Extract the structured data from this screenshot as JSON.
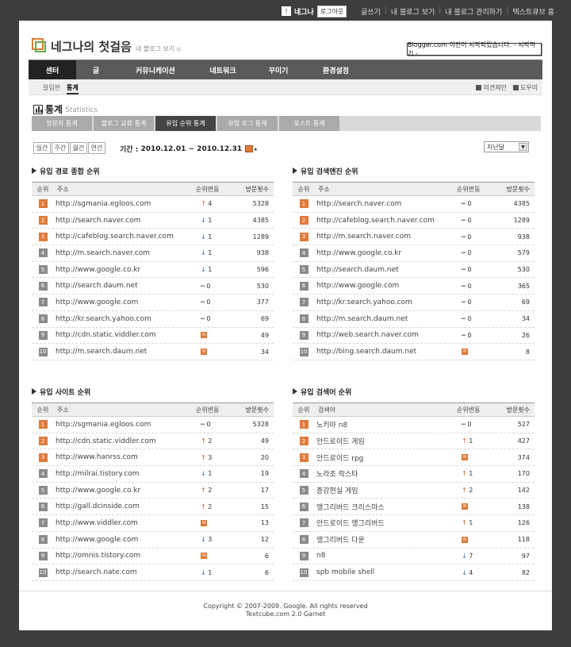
{
  "topbar": {
    "user_icon": "!",
    "user": "네그나",
    "logout": "로그아웃",
    "links": [
      "글쓰기",
      "내 블로그 보기",
      "내 블로그 관리하기",
      "텍스트큐브 홈"
    ]
  },
  "header": {
    "title": "네그나의 첫걸음",
    "view_blog": "내 블로그 보기",
    "notice": "Blogger.com 이전이 시작되었습니다. - 시작하기 -"
  },
  "nav": {
    "items": [
      "센터",
      "글",
      "커뮤니케이션",
      "네트워크",
      "꾸미기",
      "환경설정"
    ],
    "active": 0
  },
  "subnav": {
    "items": [
      "알림판",
      "통계"
    ],
    "active": 1,
    "right": [
      "의견제안",
      "도우미"
    ]
  },
  "stats": {
    "title": "통계",
    "title_en": "Statistics",
    "tabs": [
      "방문자 통계",
      "블로그 교류 통계",
      "유입 순위 통계",
      "유입 로그 통계",
      "포스트 통계"
    ],
    "active_tab": 2,
    "period_buttons": [
      "일간",
      "주간",
      "월간",
      "연간"
    ],
    "period_label": "기간 :",
    "period_value": "2010.12.01 ~ 2010.12.31",
    "period_select": "지난달"
  },
  "colors": {
    "accent_orange": "#e07a3a",
    "rank_grey": "#8a8a8a",
    "nav_bg": "#5a5a5a",
    "nav_active": "#222222"
  },
  "panels": [
    {
      "title": "유입 경로 종합 순위",
      "headers": [
        "순위",
        "주소",
        "순위변동",
        "방문횟수"
      ],
      "rows": [
        {
          "rank": "1",
          "name": "http://sgmania.egloos.com",
          "chg": "4",
          "dir": "up",
          "count": "5328"
        },
        {
          "rank": "2",
          "name": "http://search.naver.com",
          "chg": "1",
          "dir": "dn",
          "count": "4385"
        },
        {
          "rank": "3",
          "name": "http://cafeblog.search.naver.com",
          "chg": "1",
          "dir": "dn",
          "count": "1289"
        },
        {
          "rank": "4",
          "name": "http://m.search.naver.com",
          "chg": "1",
          "dir": "dn",
          "count": "938"
        },
        {
          "rank": "5",
          "name": "http://www.google.co.kr",
          "chg": "1",
          "dir": "dn",
          "count": "596"
        },
        {
          "rank": "6",
          "name": "http://search.daum.net",
          "chg": "0",
          "dir": "eq",
          "count": "530"
        },
        {
          "rank": "7",
          "name": "http://www.google.com",
          "chg": "0",
          "dir": "eq",
          "count": "377"
        },
        {
          "rank": "8",
          "name": "http://kr.search.yahoo.com",
          "chg": "0",
          "dir": "eq",
          "count": "69"
        },
        {
          "rank": "9",
          "name": "http://cdn.static.viddler.com",
          "chg": "N",
          "dir": "new",
          "count": "49"
        },
        {
          "rank": "10",
          "name": "http://m.search.daum.net",
          "chg": "N",
          "dir": "new",
          "count": "34"
        }
      ]
    },
    {
      "title": "유입 검색엔진 순위",
      "headers": [
        "순위",
        "주소",
        "순위변동",
        "방문횟수"
      ],
      "rows": [
        {
          "rank": "1",
          "name": "http://search.naver.com",
          "chg": "0",
          "dir": "eq",
          "count": "4385"
        },
        {
          "rank": "2",
          "name": "http://cafeblog.search.naver.com",
          "chg": "0",
          "dir": "eq",
          "count": "1289"
        },
        {
          "rank": "3",
          "name": "http://m.search.naver.com",
          "chg": "0",
          "dir": "eq",
          "count": "938"
        },
        {
          "rank": "4",
          "name": "http://www.google.co.kr",
          "chg": "0",
          "dir": "eq",
          "count": "579"
        },
        {
          "rank": "5",
          "name": "http://search.daum.net",
          "chg": "0",
          "dir": "eq",
          "count": "530"
        },
        {
          "rank": "6",
          "name": "http://www.google.com",
          "chg": "0",
          "dir": "eq",
          "count": "365"
        },
        {
          "rank": "7",
          "name": "http://kr.search.yahoo.com",
          "chg": "0",
          "dir": "eq",
          "count": "69"
        },
        {
          "rank": "8",
          "name": "http://m.search.daum.net",
          "chg": "0",
          "dir": "eq",
          "count": "34"
        },
        {
          "rank": "9",
          "name": "http://web.search.naver.com",
          "chg": "0",
          "dir": "eq",
          "count": "26"
        },
        {
          "rank": "10",
          "name": "http://bing.search.daum.net",
          "chg": "N",
          "dir": "new",
          "count": "8"
        }
      ]
    },
    {
      "title": "유입 사이트 순위",
      "headers": [
        "순위",
        "주소",
        "순위변동",
        "방문횟수"
      ],
      "rows": [
        {
          "rank": "1",
          "name": "http://sgmania.egloos.com",
          "chg": "0",
          "dir": "eq",
          "count": "5328"
        },
        {
          "rank": "2",
          "name": "http://cdn.static.viddler.com",
          "chg": "2",
          "dir": "up",
          "count": "49"
        },
        {
          "rank": "3",
          "name": "http://www.hanrss.com",
          "chg": "3",
          "dir": "up",
          "count": "20"
        },
        {
          "rank": "4",
          "name": "http://milrai.tistory.com",
          "chg": "1",
          "dir": "dn",
          "count": "19"
        },
        {
          "rank": "5",
          "name": "http://www.google.co.kr",
          "chg": "2",
          "dir": "up",
          "count": "17"
        },
        {
          "rank": "6",
          "name": "http://gall.dcinside.com",
          "chg": "2",
          "dir": "up",
          "count": "15"
        },
        {
          "rank": "7",
          "name": "http://www.viddler.com",
          "chg": "N",
          "dir": "new",
          "count": "13"
        },
        {
          "rank": "8",
          "name": "http://www.google.com",
          "chg": "3",
          "dir": "dn",
          "count": "12"
        },
        {
          "rank": "9",
          "name": "http://omnis.tistory.com",
          "chg": "N",
          "dir": "new",
          "count": "6"
        },
        {
          "rank": "10",
          "name": "http://search.nate.com",
          "chg": "1",
          "dir": "dn",
          "count": "6"
        }
      ]
    },
    {
      "title": "유입 검색어 순위",
      "headers": [
        "순위",
        "검색어",
        "순위변동",
        "방문횟수"
      ],
      "rows": [
        {
          "rank": "1",
          "name": "노키아 n8",
          "chg": "0",
          "dir": "eq",
          "count": "527"
        },
        {
          "rank": "2",
          "name": "안드로이드 게임",
          "chg": "1",
          "dir": "up",
          "count": "427"
        },
        {
          "rank": "3",
          "name": "안드로이드 rpg",
          "chg": "N",
          "dir": "new",
          "count": "374"
        },
        {
          "rank": "4",
          "name": "노라조 락스타",
          "chg": "1",
          "dir": "up",
          "count": "170"
        },
        {
          "rank": "5",
          "name": "증강현실 게임",
          "chg": "2",
          "dir": "up",
          "count": "142"
        },
        {
          "rank": "6",
          "name": "앵그리버드 크리스마스",
          "chg": "N",
          "dir": "new",
          "count": "138"
        },
        {
          "rank": "7",
          "name": "안드로이드 앵그리버드",
          "chg": "1",
          "dir": "up",
          "count": "126"
        },
        {
          "rank": "8",
          "name": "앵그리버드 다운",
          "chg": "N",
          "dir": "new",
          "count": "118"
        },
        {
          "rank": "9",
          "name": "n8",
          "chg": "7",
          "dir": "dn",
          "count": "97"
        },
        {
          "rank": "10",
          "name": "spb mobile shell",
          "chg": "4",
          "dir": "dn",
          "count": "82"
        }
      ]
    }
  ],
  "footer": {
    "line1": "Copyright © 2007-2009. Google. All rights reserved",
    "line2": "Textcube.com 2.0 Garnet"
  }
}
